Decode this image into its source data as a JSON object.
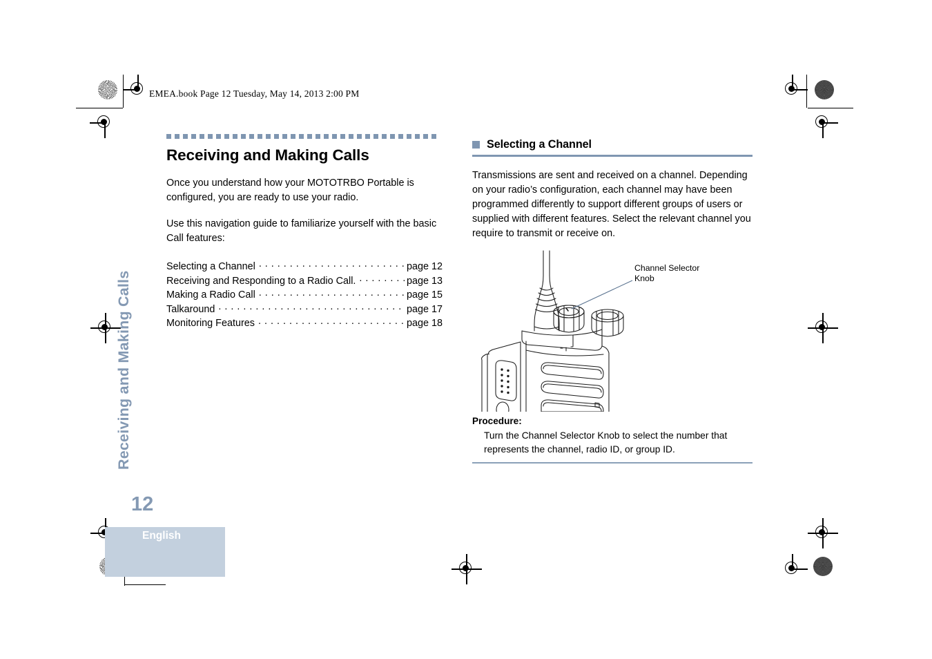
{
  "file_header": "EMEA.book  Page 12  Tuesday, May 14, 2013  2:00 PM",
  "running_head": "Receiving and Making Calls",
  "left_column": {
    "chapter_title": "Receiving and Making Calls",
    "intro_paragraph_1": "Once you understand how your MOTOTRBO Portable is configured, you are ready to use your radio.",
    "intro_paragraph_2": "Use this navigation guide to familiarize yourself with the basic Call features:",
    "toc": [
      {
        "title": "Selecting a Channel",
        "page": "page 12"
      },
      {
        "title": "Receiving and Responding to a Radio Call.",
        "page": "page 13"
      },
      {
        "title": "Making a Radio Call",
        "page": "page 15"
      },
      {
        "title": "Talkaround",
        "page": "page 17"
      },
      {
        "title": "Monitoring Features",
        "page": "page 18"
      }
    ]
  },
  "right_column": {
    "section_title": "Selecting a Channel",
    "body_paragraph": "Transmissions are sent and received on a channel. Depending on your radio’s configuration, each channel may have been programmed differently to support different groups of users or supplied with different features. Select the relevant channel you require to transmit or receive on.",
    "figure": {
      "callout_line_1": "Channel Selector",
      "callout_line_2": "Knob",
      "alt": "Line drawing of a MOTOTRBO portable two-way radio showing the channel selector knob on top"
    },
    "procedure_label": "Procedure:",
    "procedure_text": "Turn the Channel Selector Knob to select the number that represents the channel, radio ID, or group ID."
  },
  "footer": {
    "page_number": "12",
    "language": "English"
  },
  "colors": {
    "accent_blue_gray": "#7f96b1",
    "running_head": "#8499b3",
    "language_box": "#c3d0de",
    "text": "#000000"
  }
}
